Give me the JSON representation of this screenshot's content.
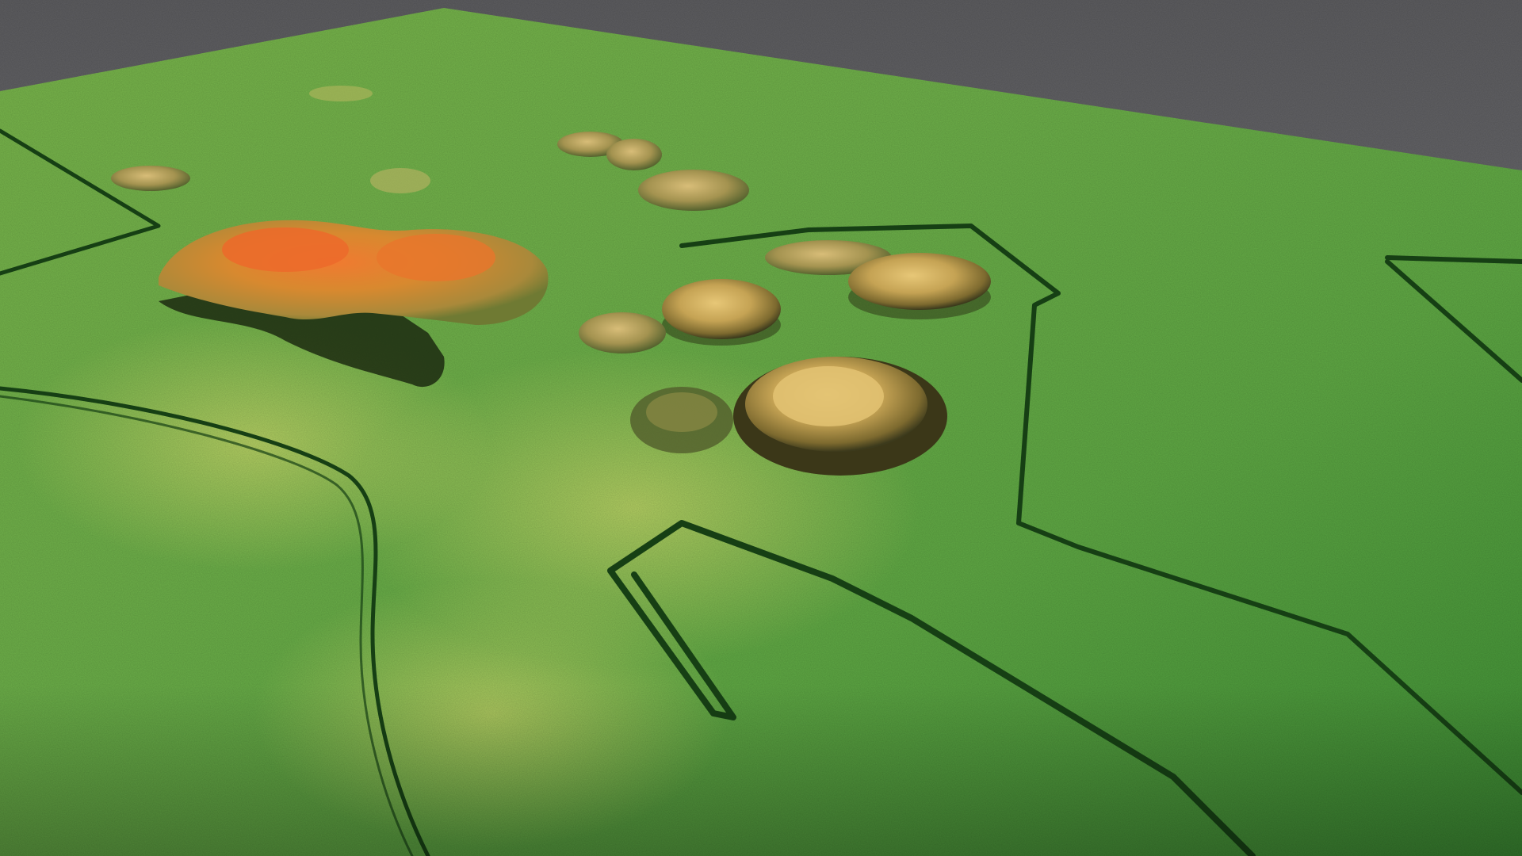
{
  "scene": {
    "kind": "lidar-terrain-render",
    "view": "oblique-3d",
    "colormap": {
      "low": "#3f9a3a",
      "mid": "#9cc24a",
      "high": "#d98a34",
      "peak": "#e8682a"
    },
    "background": "#6e6e71",
    "features": {
      "mounds": 14,
      "field_boundaries": 4,
      "tracks": 1
    }
  }
}
